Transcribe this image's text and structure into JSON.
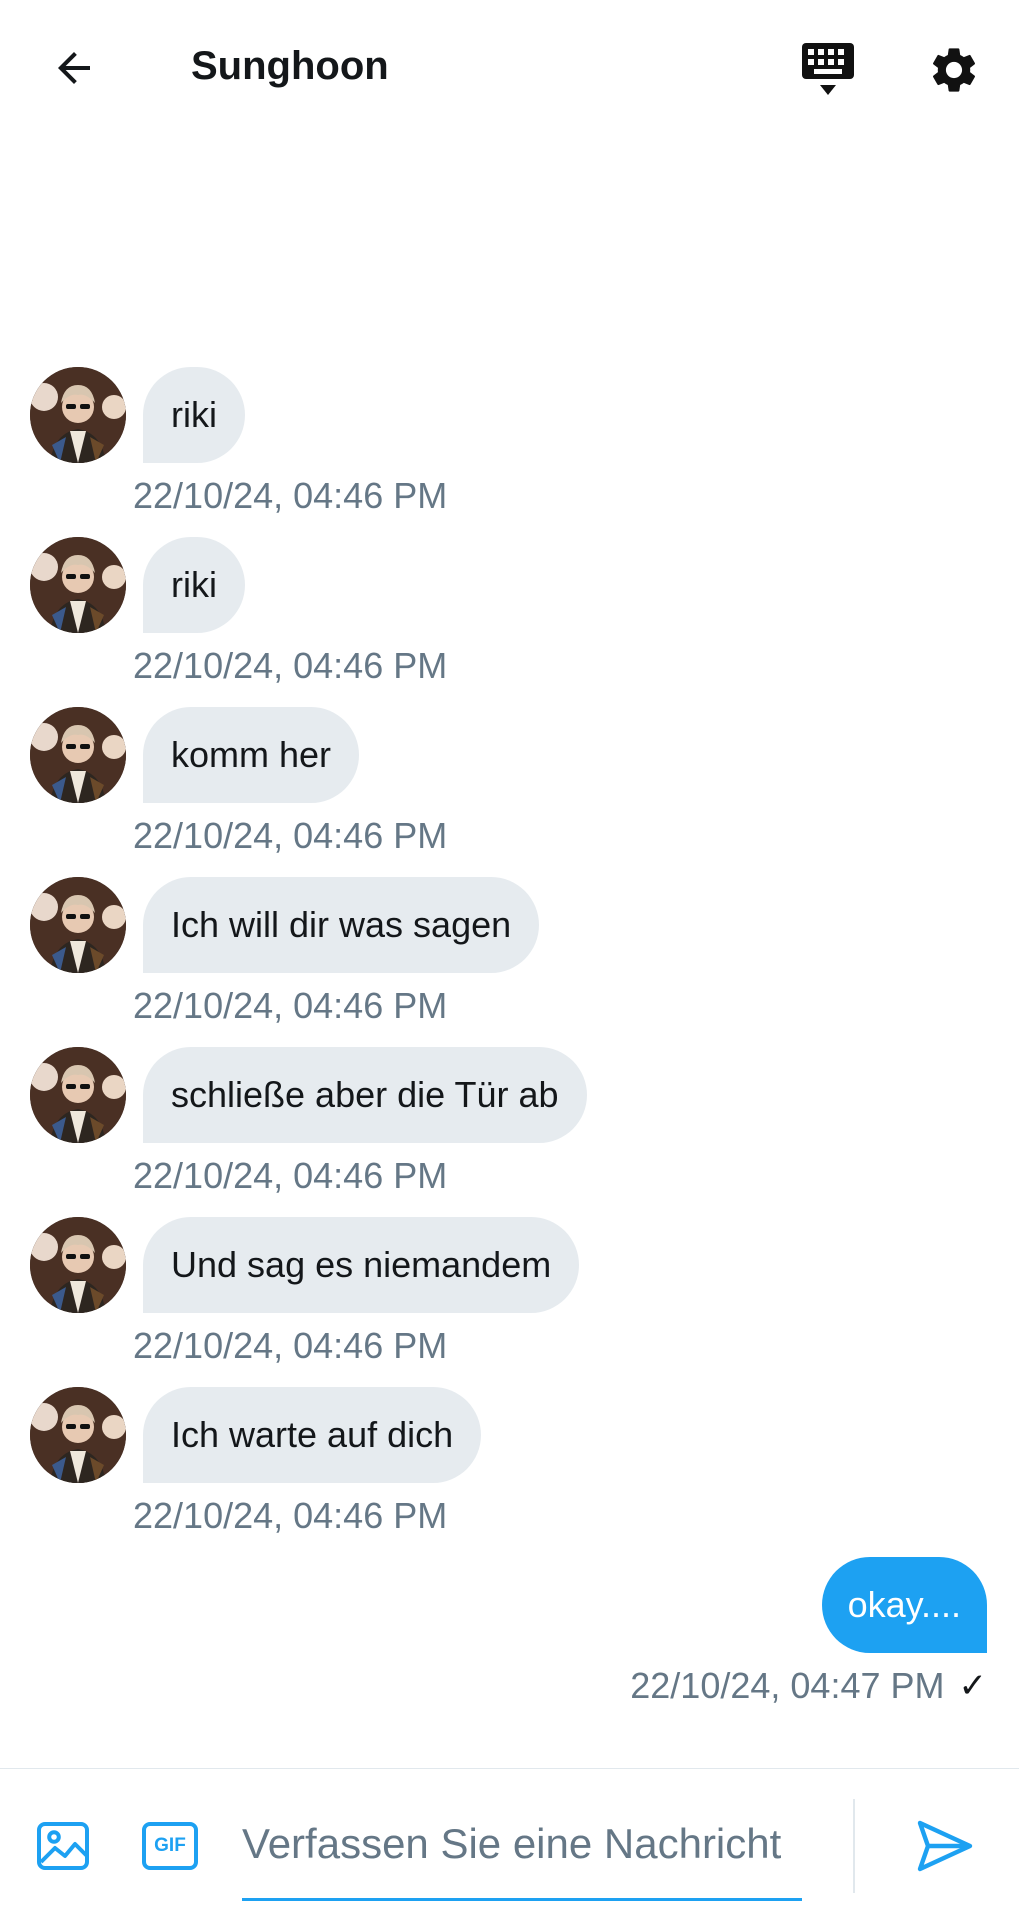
{
  "header": {
    "title": "Sunghoon",
    "back_icon": "arrow-left-icon",
    "keyboard_icon": "keyboard-icon",
    "settings_icon": "gear-icon"
  },
  "messages": [
    {
      "direction": "in",
      "text": "riki",
      "time": "22/10/24, 04:46 PM"
    },
    {
      "direction": "in",
      "text": "riki",
      "time": "22/10/24, 04:46 PM"
    },
    {
      "direction": "in",
      "text": "komm her",
      "time": "22/10/24, 04:46 PM"
    },
    {
      "direction": "in",
      "text": "Ich will dir was sagen",
      "time": "22/10/24, 04:46 PM"
    },
    {
      "direction": "in",
      "text": "schließe aber die Tür ab",
      "time": "22/10/24, 04:46 PM"
    },
    {
      "direction": "in",
      "text": "Und sag es niemandem",
      "time": "22/10/24, 04:46 PM"
    },
    {
      "direction": "in",
      "text": "Ich warte auf dich",
      "time": "22/10/24, 04:46 PM"
    },
    {
      "direction": "out",
      "text": "okay....",
      "time": "22/10/24, 04:47 PM",
      "status": "✓"
    }
  ],
  "composer": {
    "placeholder": "Verfassen Sie eine Nachricht",
    "value": "",
    "gif_label": "GIF",
    "media_icon": "image-icon",
    "send_icon": "send-icon"
  },
  "colors": {
    "accent": "#1da1f2",
    "incoming_bubble": "#e6ebef",
    "timestamp": "#657786"
  }
}
